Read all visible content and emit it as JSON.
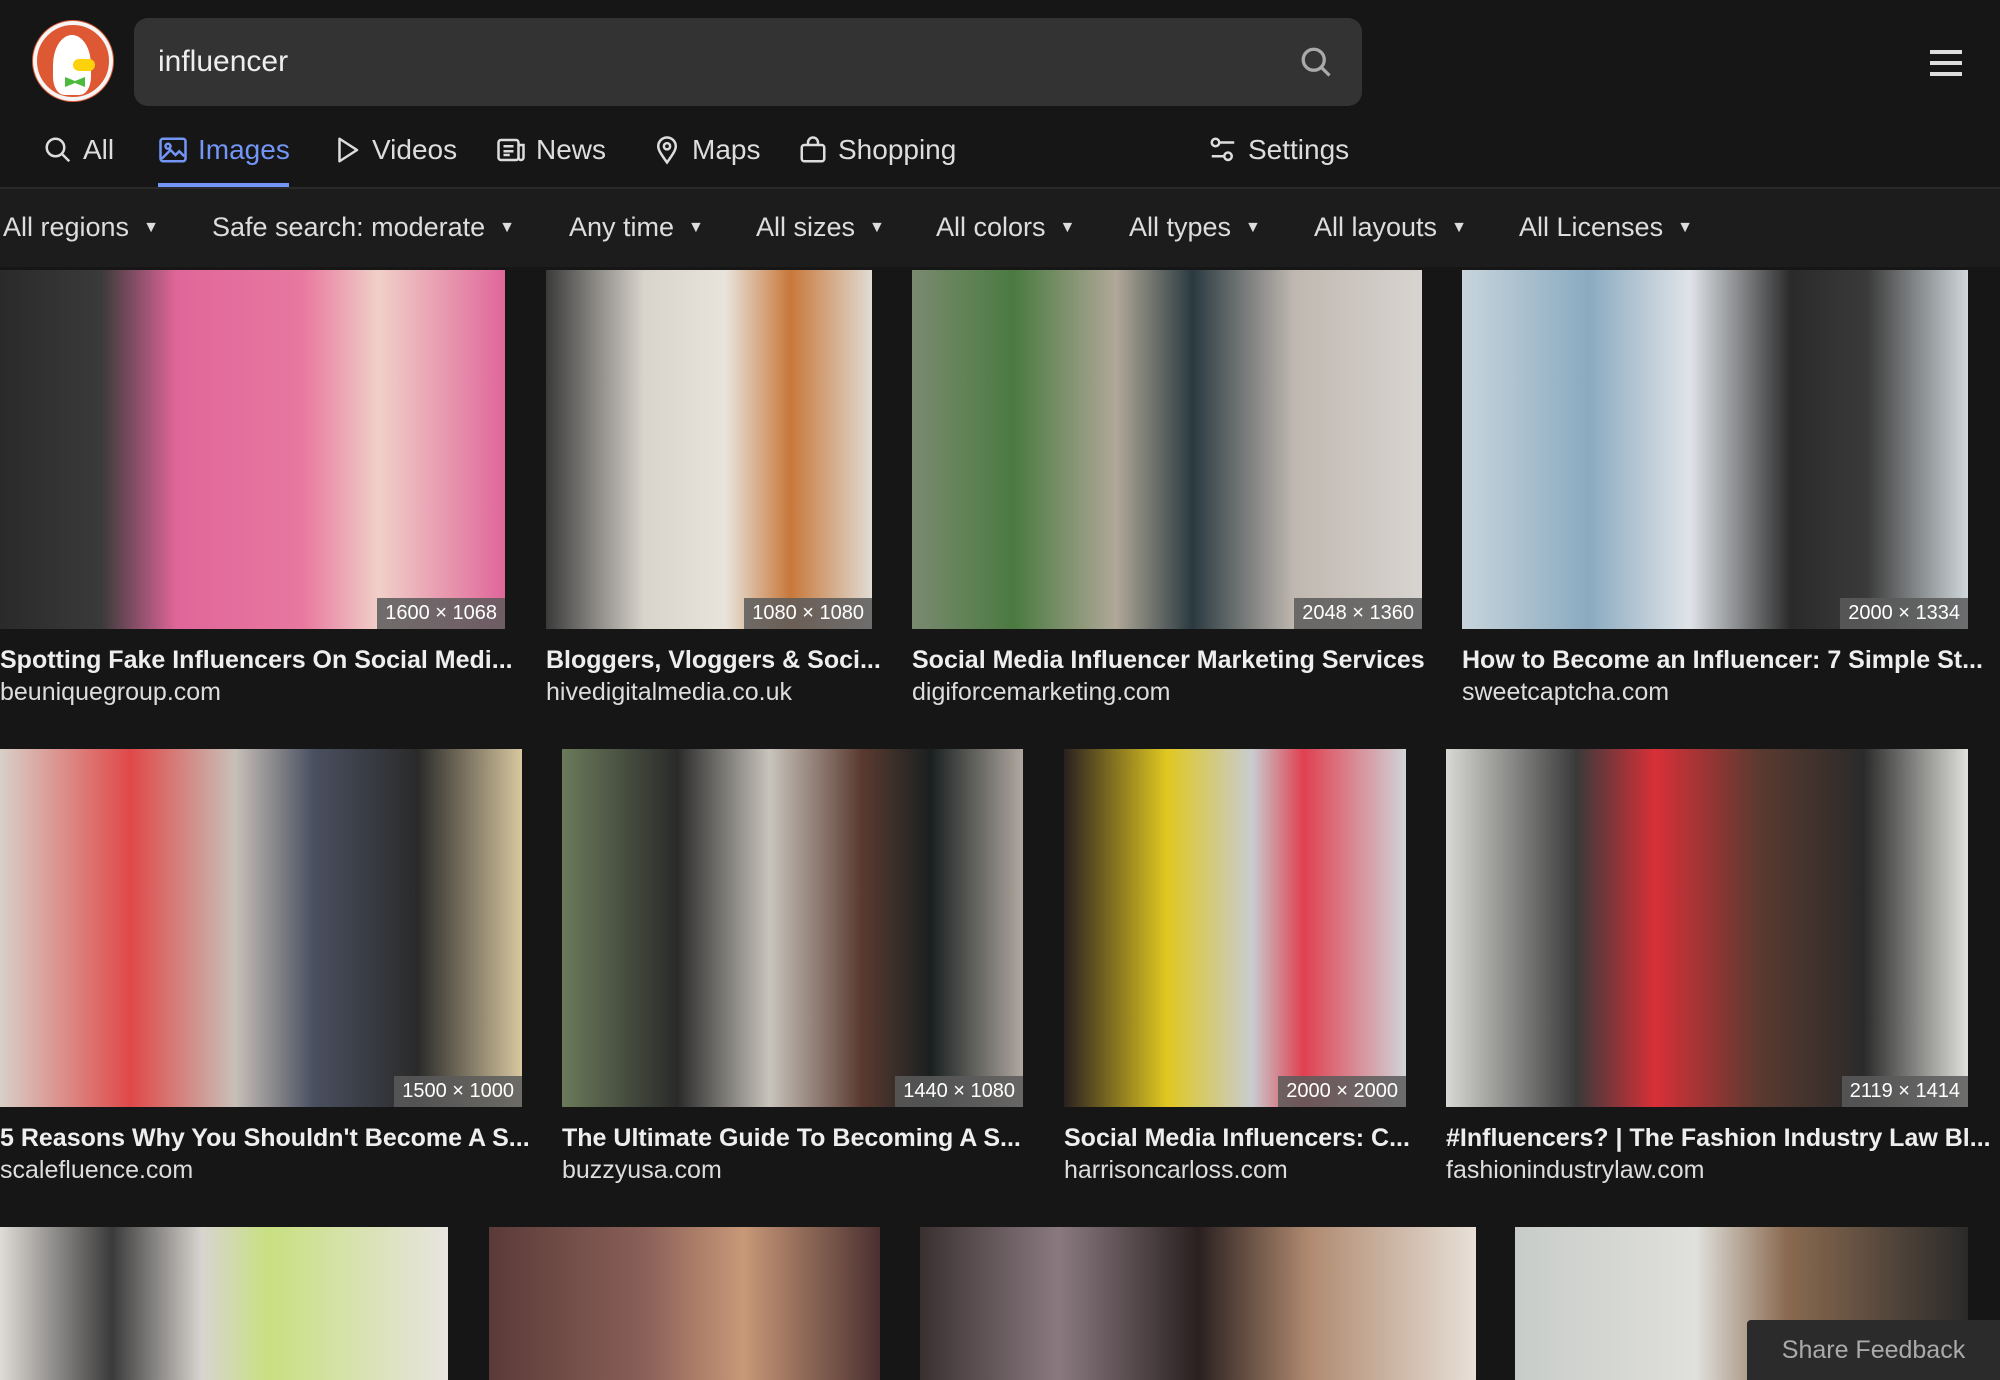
{
  "search": {
    "query": "influencer"
  },
  "colors": {
    "accent": "#7295f6",
    "background": "#161616",
    "search_box": "#333333"
  },
  "tabs": [
    {
      "label": "All",
      "icon": "search-icon"
    },
    {
      "label": "Images",
      "icon": "image-icon",
      "active": true
    },
    {
      "label": "Videos",
      "icon": "play-icon"
    },
    {
      "label": "News",
      "icon": "newspaper-icon"
    },
    {
      "label": "Maps",
      "icon": "map-pin-icon"
    },
    {
      "label": "Shopping",
      "icon": "shopping-bag-icon"
    }
  ],
  "settings": {
    "label": "Settings",
    "icon": "sliders-icon"
  },
  "filters": [
    "All regions",
    "Safe search: moderate",
    "Any time",
    "All sizes",
    "All colors",
    "All types",
    "All layouts",
    "All Licenses"
  ],
  "results": [
    {
      "title": "Spotting Fake Influencers On Social Medi...",
      "domain": "beuniquegroup.com",
      "dims": "1600 × 1068"
    },
    {
      "title": "Bloggers, Vloggers & Soci...",
      "domain": "hivedigitalmedia.co.uk",
      "dims": "1080 × 1080"
    },
    {
      "title": "Social Media Influencer Marketing Services",
      "domain": "digiforcemarketing.com",
      "dims": "2048 × 1360"
    },
    {
      "title": "How to Become an Influencer: 7 Simple St...",
      "domain": "sweetcaptcha.com",
      "dims": "2000 × 1334"
    },
    {
      "title": "5 Reasons Why You Shouldn't Become A S...",
      "domain": "scalefluence.com",
      "dims": "1500 × 1000"
    },
    {
      "title": "The Ultimate Guide To Becoming A S...",
      "domain": "buzzyusa.com",
      "dims": "1440 × 1080"
    },
    {
      "title": "Social Media Influencers: C...",
      "domain": "harrisoncarloss.com",
      "dims": "2000 × 2000"
    },
    {
      "title": "#Influencers? | The Fashion Industry Law Bl...",
      "domain": "fashionindustrylaw.com",
      "dims": "2119 × 1414"
    }
  ],
  "feedback": {
    "label": "Share Feedback"
  }
}
